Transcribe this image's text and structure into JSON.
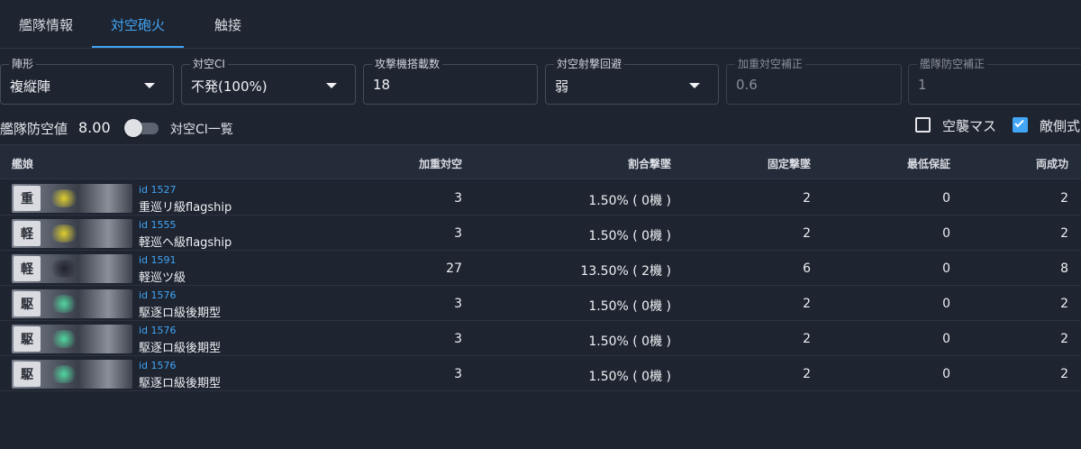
{
  "tabs": [
    {
      "label": "艦隊情報"
    },
    {
      "label": "対空砲火"
    },
    {
      "label": "触接"
    }
  ],
  "fields": {
    "formation": {
      "label": "陣形",
      "value": "複縦陣"
    },
    "aaci": {
      "label": "対空CI",
      "value": "不発(100%)"
    },
    "attackers": {
      "label": "攻撃機搭載数",
      "value": "18"
    },
    "evasion": {
      "label": "対空射撃回避",
      "value": "弱"
    },
    "weighted_correction": {
      "label": "加重対空補正",
      "value": "0.6"
    },
    "fleet_correction": {
      "label": "艦隊防空補正",
      "value": "1"
    }
  },
  "controls": {
    "fleet_defense_label": "艦隊防空値",
    "fleet_defense_value": "8.00",
    "aaci_list_label": "対空CI一覧",
    "aaci_list_on": false,
    "air_raid_label": "空襲マス",
    "air_raid_checked": false,
    "enemy_side_label": "敵側式",
    "enemy_side_checked": true
  },
  "table": {
    "headers": {
      "ship": "艦娘",
      "weighted": "加重対空",
      "proportional": "割合撃墜",
      "fixed": "固定撃墜",
      "minimum": "最低保証",
      "both": "両成功"
    },
    "rows": [
      {
        "kanji": "重",
        "glow": "yellow",
        "id": "id 1527",
        "name": "重巡リ級flagship",
        "weighted": "3",
        "proportional": "1.50% ( 0機 )",
        "fixed": "2",
        "minimum": "0",
        "both": "2"
      },
      {
        "kanji": "軽",
        "glow": "yellow",
        "id": "id 1555",
        "name": "軽巡ヘ級flagship",
        "weighted": "3",
        "proportional": "1.50% ( 0機 )",
        "fixed": "2",
        "minimum": "0",
        "both": "2"
      },
      {
        "kanji": "軽",
        "glow": "grey",
        "id": "id 1591",
        "name": "軽巡ツ級",
        "weighted": "27",
        "proportional": "13.50% ( 2機 )",
        "fixed": "6",
        "minimum": "0",
        "both": "8"
      },
      {
        "kanji": "駆",
        "glow": "green",
        "id": "id 1576",
        "name": "駆逐ロ級後期型",
        "weighted": "3",
        "proportional": "1.50% ( 0機 )",
        "fixed": "2",
        "minimum": "0",
        "both": "2"
      },
      {
        "kanji": "駆",
        "glow": "green",
        "id": "id 1576",
        "name": "駆逐ロ級後期型",
        "weighted": "3",
        "proportional": "1.50% ( 0機 )",
        "fixed": "2",
        "minimum": "0",
        "both": "2"
      },
      {
        "kanji": "駆",
        "glow": "green",
        "id": "id 1576",
        "name": "駆逐ロ級後期型",
        "weighted": "3",
        "proportional": "1.50% ( 0機 )",
        "fixed": "2",
        "minimum": "0",
        "both": "2"
      }
    ]
  },
  "colors": {
    "background": "#1e2430",
    "accent": "#42a5f5",
    "header_bg": "#252c39"
  }
}
